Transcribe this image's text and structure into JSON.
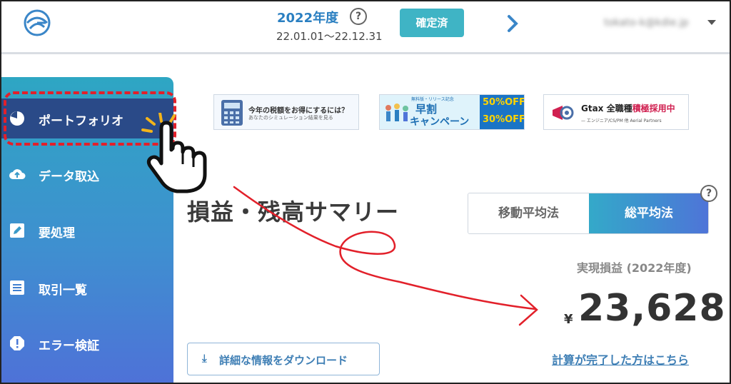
{
  "header": {
    "year_label": "2022年度",
    "help_glyph": "?",
    "period": "22.01.01〜22.12.31",
    "confirm_button": "確定済",
    "account_email": "tokato-k@kdie.jp"
  },
  "sidebar": {
    "items": [
      {
        "label": "ポートフォリオ",
        "icon": "pie-chart-icon"
      },
      {
        "label": "データ取込",
        "icon": "cloud-upload-icon"
      },
      {
        "label": "要処理",
        "icon": "edit-icon"
      },
      {
        "label": "取引一覧",
        "icon": "list-icon"
      },
      {
        "label": "エラー検証",
        "icon": "alert-icon"
      }
    ]
  },
  "banners": {
    "b1": {
      "title": "今年の税額をお得にするには？",
      "subtitle": "あなたのシミュレーション結果を見る"
    },
    "b2": {
      "small": "無料版・リリース記念",
      "line1": "早割",
      "line2": "キャンペーン",
      "off1": "50%OFF!",
      "off2": "30%OFF!"
    },
    "b3": {
      "title_a": "Gtax 全職種",
      "title_b": "積極採用中",
      "subtitle": "— エンジニア/CS/PM 他  Aerial Partners"
    }
  },
  "main": {
    "title": "損益・残高サマリー",
    "method_a": "移動平均法",
    "method_b": "総平均法",
    "help_glyph": "?",
    "realized_label": "実現損益 (2022年度)",
    "currency": "¥",
    "realized_value": "23,628",
    "download_icon": "⤓",
    "download_button": "詳細な情報をダウンロード",
    "calc_link": "計算が完了した方はこちら"
  },
  "colors": {
    "accent": "#2a7fc1",
    "confirm": "#3fb4c5",
    "sidebar_active": "#2a4a88",
    "annotation_red": "#e2202a"
  }
}
